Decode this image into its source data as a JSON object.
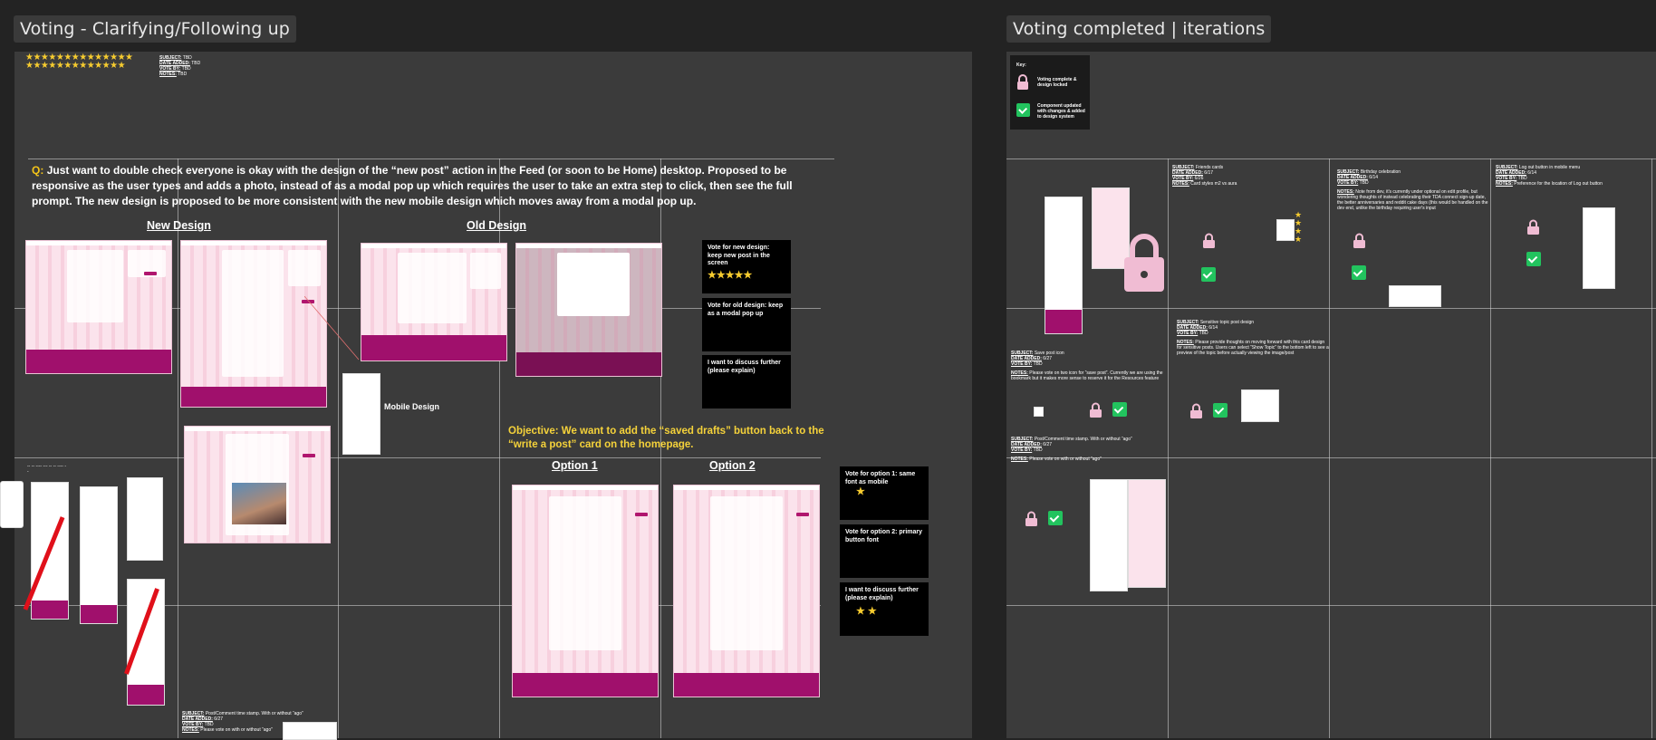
{
  "left_frame": {
    "title": "Voting - Clarifying/Following up",
    "meta": {
      "subject_label": "SUBJECT:",
      "subject_value": "TBD",
      "date_label": "DATE ADDED:",
      "date_value": "TBD",
      "vote_label": "VOTE BY:",
      "vote_value": "TBD",
      "notes_label": "NOTES:",
      "notes_value": "TBD"
    },
    "question_label": "Q:",
    "question_text": "Just want to double check everyone is okay with the design of the “new post” action in the Feed (or soon to be Home) desktop. Proposed to be responsive as the user types and adds a photo, instead of as a modal pop up which requires the user to take an extra step to click, then see the full prompt. The new design is proposed to be more consistent with the new mobile design which moves away from a modal pop up.",
    "new_design_heading": "New Design",
    "old_design_heading": "Old Design",
    "mobile_design_label": "Mobile Design",
    "votes_1": [
      {
        "label": "Vote for new design: keep new post in the screen",
        "stars": "★★★★★"
      },
      {
        "label": "Vote for old design: keep as a modal pop up",
        "stars": ""
      },
      {
        "label": "I want to discuss further (please explain)",
        "stars": ""
      }
    ],
    "objective": "Objective: We want to add the “saved drafts” button back to the “write a post” card on the homepage.",
    "option1_heading": "Option 1",
    "option2_heading": "Option 2",
    "votes_2": [
      {
        "label": "Vote for option 1: same font as mobile",
        "stars": "★"
      },
      {
        "label": "Vote for option 2: primary button font",
        "stars": ""
      },
      {
        "label": "I want to discuss further (please explain)",
        "stars": "★ ★"
      }
    ],
    "bottom_meta": {
      "subject_label": "SUBJECT:",
      "subject_value": "Post/Comment time stamp. With or without “ago”",
      "date_label": "DATE ADDED:",
      "date_value": "6/27",
      "vote_label": "VOTE BY:",
      "vote_value": "TBD",
      "notes_label": "NOTES:",
      "notes_value": "Please vote on with or without “ago”"
    },
    "star_rows": [
      "★★★★★★★★★★★★★★",
      "★★★★★★★★★★★★★"
    ]
  },
  "right_frame": {
    "title": "Voting completed | iterations",
    "key": {
      "title": "Key:",
      "lock_text": "Voting complete & design locked",
      "check_text": "Component updated with changes & added to design system"
    },
    "friends_cards": {
      "subject_label": "SUBJECT:",
      "subject_value": "Friends cards",
      "date_label": "DATE ADDED:",
      "date_value": "6/17",
      "vote_label": "VOTE BY:",
      "vote_value": "6/26",
      "notes_label": "NOTES:",
      "notes_value": "Card styles m2 vs aura"
    },
    "birthday": {
      "subject_label": "SUBJECT:",
      "subject_value": "Birthday celebration",
      "date_label": "DATE ADDED:",
      "date_value": "6/14",
      "vote_label": "VOTE BY:",
      "vote_value": "TBD",
      "notes_label": "NOTES:",
      "notes_value": "Note from dev, it's currently under optional on edit profile, but wondering thoughts of instead celebrating their TDA connect sign-up date, the better anniversaries and reddit cake days (this would be handled on the dev end, unlike the birthday requiring user's input"
    },
    "logout": {
      "subject_label": "SUBJECT:",
      "subject_value": "Log out button in mobile menu",
      "date_label": "DATE ADDED:",
      "date_value": "6/14",
      "vote_label": "VOTE BY:",
      "vote_value": "TBD",
      "notes_label": "NOTES:",
      "notes_value": "Preference for the location of Log out button"
    },
    "sensitive": {
      "subject_label": "SUBJECT:",
      "subject_value": "Sensitive topic post design",
      "date_label": "DATE ADDED:",
      "date_value": "6/14",
      "vote_label": "VOTE BY:",
      "vote_value": "TBD",
      "notes_label": "NOTES:",
      "notes_value": "Please provide thoughts on moving forward with this card design for sensitive posts. Users can select “Show Topic” to the bottom left to see a preview of the topic before actually viewing the image/post"
    },
    "save_post": {
      "subject_label": "SUBJECT:",
      "subject_value": "Save post icon",
      "date_label": "DATE ADDED:",
      "date_value": "6/27",
      "vote_label": "VOTE BY:",
      "vote_value": "TBD",
      "notes_label": "NOTES:",
      "notes_value": "Please vote on two icon for “save post”. Currently we are using the bookmark but it makes more sense to reserve it for the Resources feature"
    },
    "timestamp": {
      "subject_label": "SUBJECT:",
      "subject_value": "Post/Comment time stamp. With or without “ago”",
      "date_label": "DATE ADDED:",
      "date_value": "6/27",
      "vote_label": "VOTE BY:",
      "vote_value": "TBD",
      "notes_label": "NOTES:",
      "notes_value": "Please vote on with or without “ago”"
    }
  },
  "colors": {
    "canvas": "#232323",
    "frame": "#3b3b3b",
    "brand_magenta": "#a0106c",
    "mock_pink": "#fbe3ec",
    "accent_yellow": "#f5d23a",
    "lock_pink": "#f0bcd3",
    "check_green": "#22c35e"
  }
}
